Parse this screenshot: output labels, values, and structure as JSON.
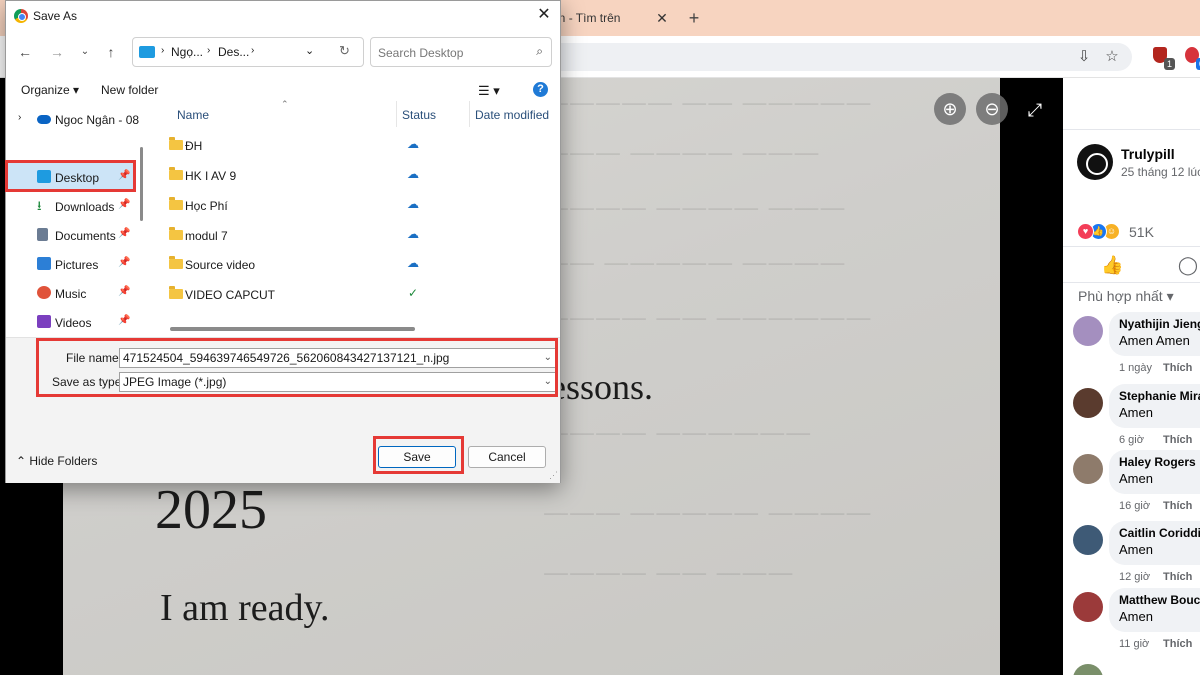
{
  "browser": {
    "tab_title": "to icon - Tìm trên",
    "tab_close": "✕",
    "new_tab": "+"
  },
  "photo_text": {
    "line1": "essons.",
    "line2": "2025",
    "line3": "I am ready."
  },
  "facebook": {
    "author": "Trulypill",
    "post_time": "25 tháng 12 lúc",
    "reaction_count": "51K",
    "sort_label": "Phù hợp nhất",
    "comments": [
      {
        "name": "Nyathijin Jieng",
        "text": "Amen Amen",
        "time": "1 ngày",
        "like": "Thích",
        "avatar_color": "#a48fbf"
      },
      {
        "name": "Stephanie Mira",
        "text": "Amen",
        "time": "6 giờ",
        "like": "Thích",
        "avatar_color": "#5a3b2e"
      },
      {
        "name": "Haley Rogers",
        "text": "Amen",
        "time": "16 giờ",
        "like": "Thích",
        "avatar_color": "#8e7b6b"
      },
      {
        "name": "Caitlin Coriddi",
        "text": "Amen",
        "time": "12 giờ",
        "like": "Thích",
        "avatar_color": "#3e5a76"
      },
      {
        "name": "Matthew Bouch",
        "text": "Amen",
        "time": "11 giờ",
        "like": "Thích",
        "avatar_color": "#9b3a3a"
      }
    ]
  },
  "dialog": {
    "title": "Save As",
    "breadcrumb": [
      "Ngọ...",
      "Des..."
    ],
    "search_placeholder": "Search Desktop",
    "organize": "Organize ▾",
    "new_folder": "New folder",
    "nav_items": [
      {
        "label": "Ngoc Ngân - 08",
        "icon": "cloud-icon",
        "color": "#0a64c4"
      },
      {
        "label": "Desktop",
        "icon": "desktop-icon",
        "color": "#1e9be0"
      },
      {
        "label": "Downloads",
        "icon": "download-icon",
        "color": "#1f8a3d"
      },
      {
        "label": "Documents",
        "icon": "document-icon",
        "color": "#6b7c93"
      },
      {
        "label": "Pictures",
        "icon": "picture-icon",
        "color": "#2c7fd6"
      },
      {
        "label": "Music",
        "icon": "music-icon",
        "color": "#e0533a"
      },
      {
        "label": "Videos",
        "icon": "video-icon",
        "color": "#7b3fbf"
      }
    ],
    "columns": [
      "Name",
      "Status",
      "Date modified"
    ],
    "files": [
      {
        "name": "ĐH",
        "status": "cloud"
      },
      {
        "name": "HK I AV 9",
        "status": "cloud"
      },
      {
        "name": "Học Phí",
        "status": "cloud"
      },
      {
        "name": "modul 7",
        "status": "cloud"
      },
      {
        "name": "Source video",
        "status": "cloud"
      },
      {
        "name": "VIDEO CAPCUT",
        "status": "synced"
      }
    ],
    "file_name_label": "File name:",
    "file_name_value": "471524504_594639746549726_562060843427137121_n.jpg",
    "save_type_label": "Save as type:",
    "save_type_value": "JPEG Image (*.jpg)",
    "hide_folders": "Hide Folders",
    "save": "Save",
    "cancel": "Cancel"
  },
  "colors": {
    "highlight": "#e53935",
    "accent": "#0067c0"
  }
}
